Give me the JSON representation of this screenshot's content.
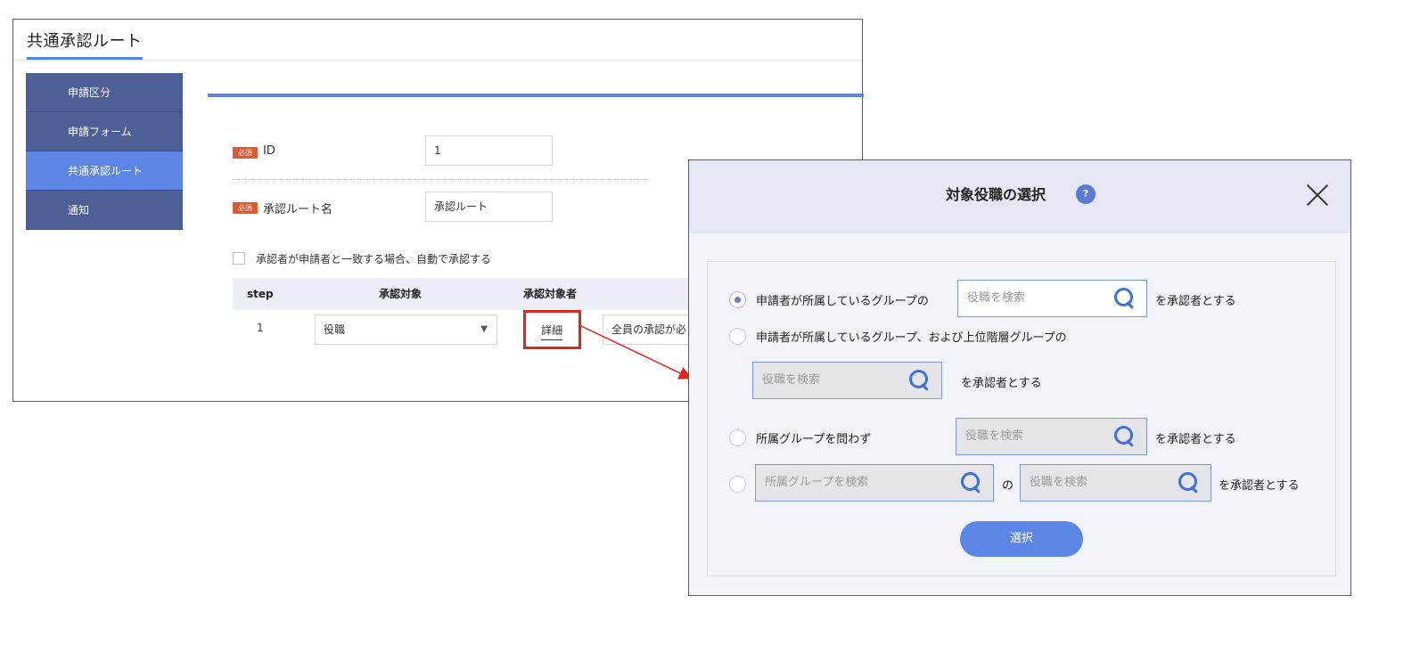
{
  "screen": {
    "title": "共通承認ルート",
    "sidebar": {
      "items": [
        {
          "label": "申請区分",
          "active": false
        },
        {
          "label": "申請フォーム",
          "active": false
        },
        {
          "label": "共通承認ルート",
          "active": true
        },
        {
          "label": "通知",
          "active": false
        }
      ]
    },
    "required_badge": "必須",
    "form": {
      "id_label": "ID",
      "id_value": "1",
      "route_name_label": "承認ルート名",
      "route_name_value": "承認ルート",
      "auto_approve_label": "承認者が申請者と一致する場合、自動で承認する",
      "auto_approve_checked": false
    },
    "table": {
      "headers": [
        "step",
        "承認対象",
        "承認対象者"
      ],
      "row": {
        "step": "1",
        "target": "役職",
        "detail_link": "詳細",
        "approval": "全員の承認が必"
      }
    }
  },
  "modal": {
    "title": "対象役職の選択",
    "help_icon": "?",
    "search_placeholder": "役職を検索",
    "group_search_placeholder": "所属グループを検索",
    "options": {
      "opt1_label": "申請者が所属しているグループの",
      "opt1_suffix": "を承認者とする",
      "opt2_label": "申請者が所属しているグループ、および上位階層グループの",
      "opt2_suffix": "を承認者とする",
      "opt3_label": "所属グループを問わず",
      "opt3_suffix": "を承認者とする",
      "opt4_connector": "の",
      "opt4_suffix": "を承認者とする"
    },
    "selected_option": 1,
    "select_button": "選択"
  },
  "colors": {
    "accent": "#5b86e6",
    "sidebar": "#4d5f95",
    "highlight": "#e0251c",
    "required": "#e4572e"
  }
}
